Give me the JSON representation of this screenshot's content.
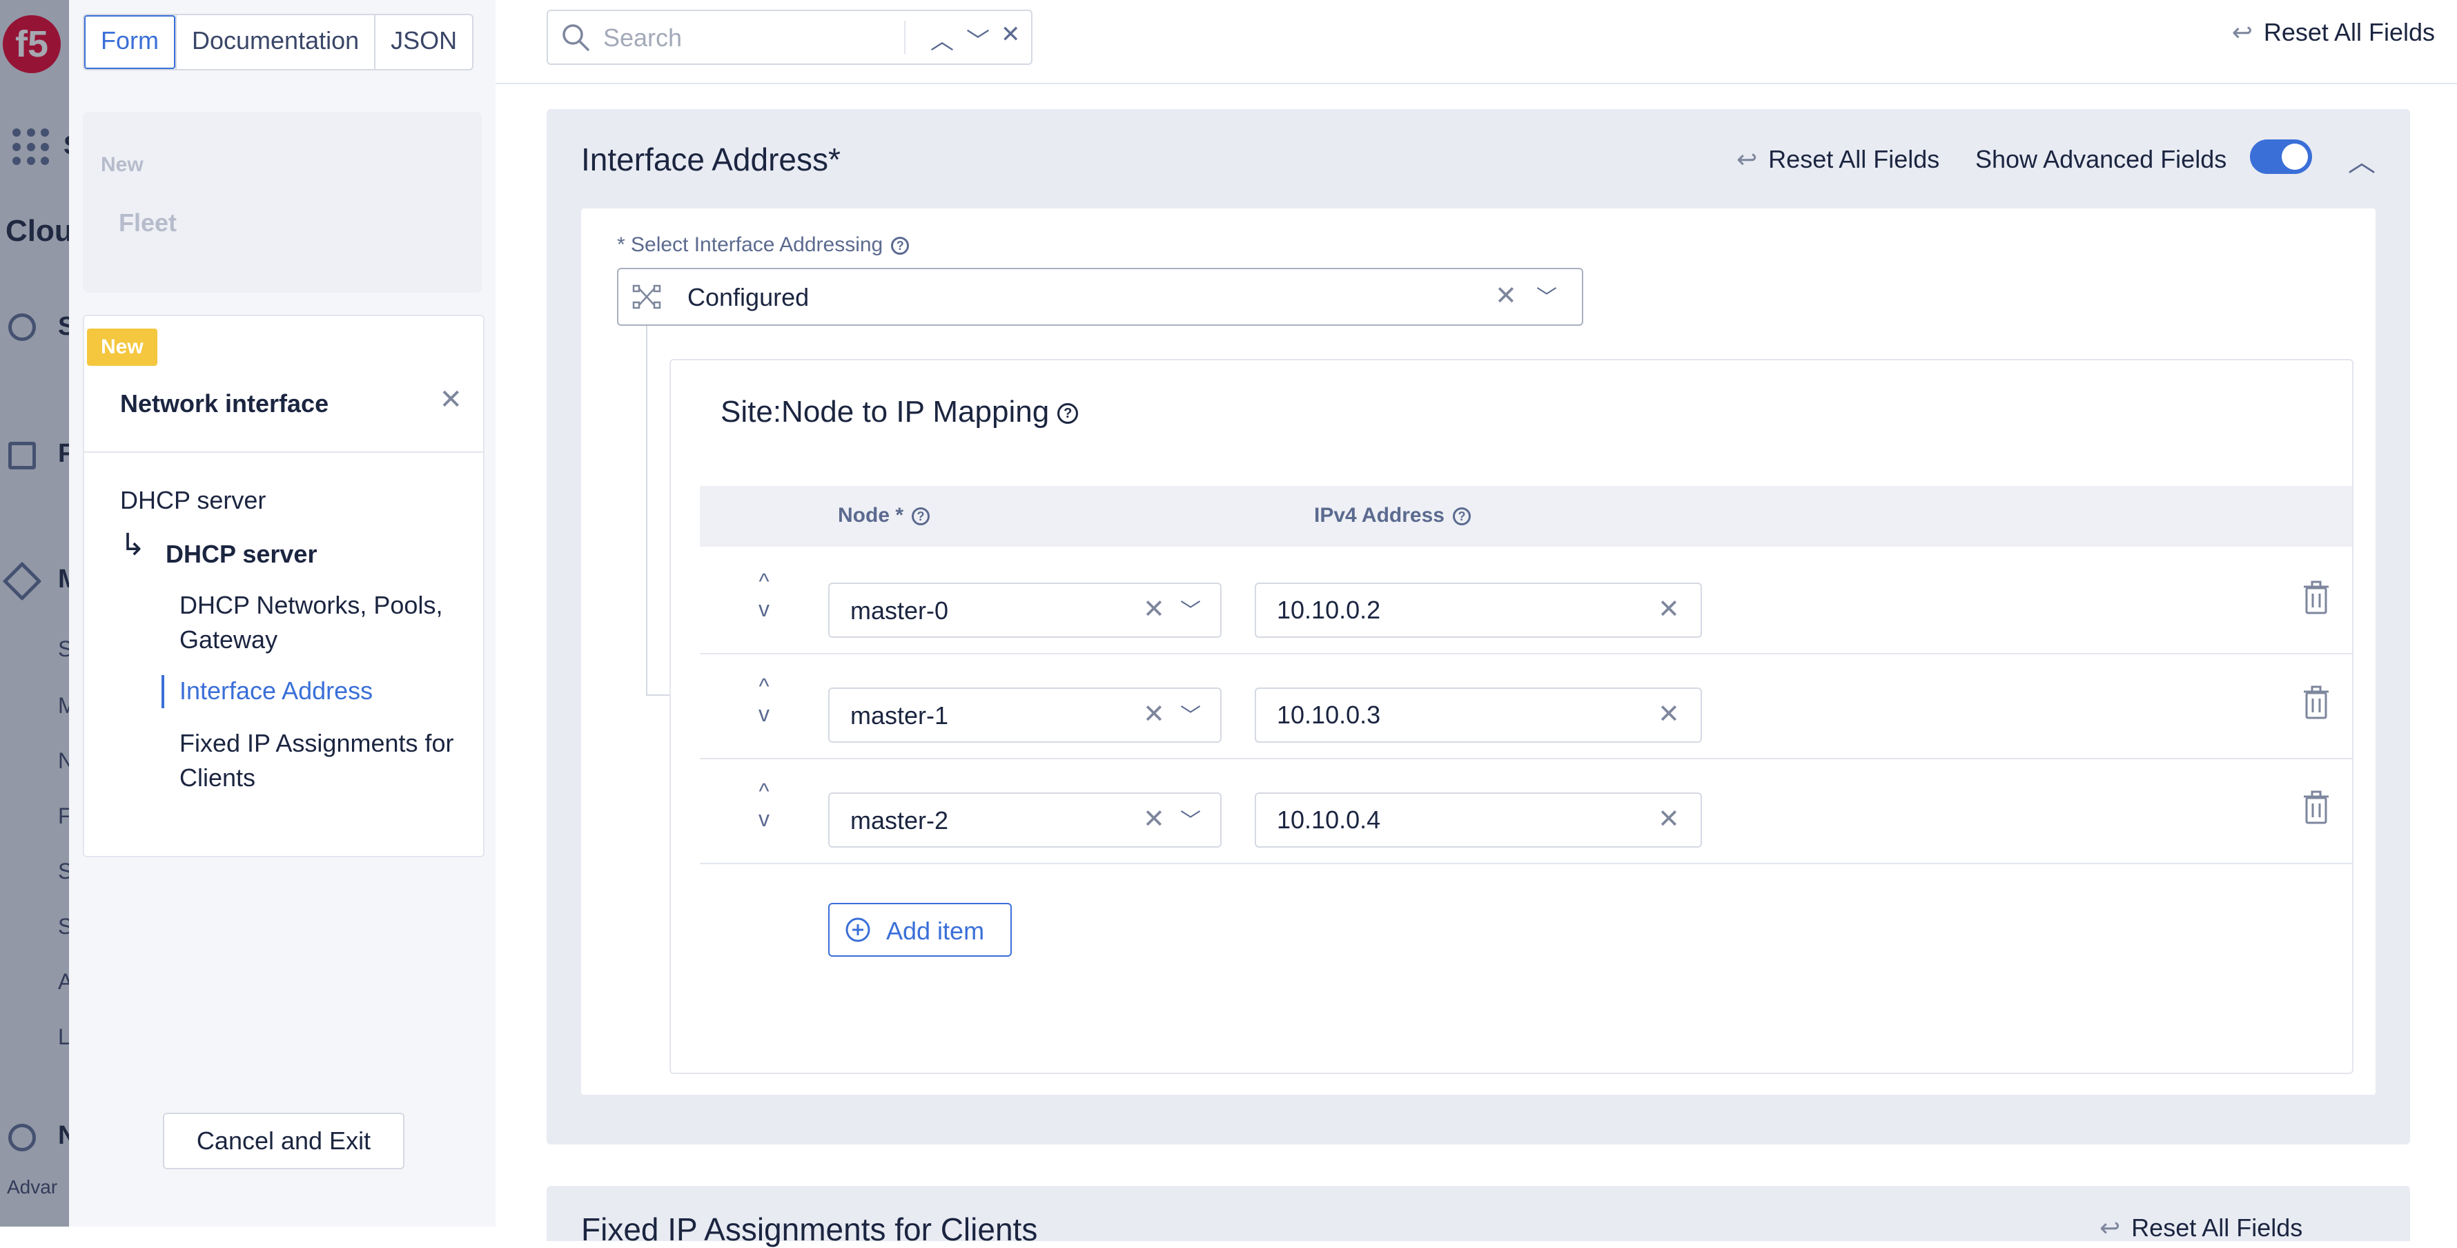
{
  "background": {
    "logo_text": "f5",
    "partial_labels": [
      "S",
      "Clou",
      "S",
      "F",
      "M",
      "S",
      "M",
      "N",
      "F",
      "S",
      "S",
      "A",
      "L",
      "N",
      "Advar"
    ]
  },
  "left_panel": {
    "tabs": [
      {
        "label": "Form",
        "active": true
      },
      {
        "label": "Documentation",
        "active": false
      },
      {
        "label": "JSON",
        "active": false
      }
    ],
    "card_new": {
      "label": "New",
      "item": "Fleet"
    },
    "card_network": {
      "badge": "New",
      "title": "Network interface",
      "close_icon": "close-icon",
      "nav": {
        "dhcp_top": "DHCP server",
        "dhcp_sub": "DHCP server",
        "networks": "DHCP Networks, Pools, Gateway",
        "interface": "Interface Address",
        "fixed_ip": "Fixed IP Assignments for Clients"
      }
    },
    "cancel_label": "Cancel and Exit"
  },
  "top_bar": {
    "search_placeholder": "Search",
    "reset_all": "Reset All Fields"
  },
  "section": {
    "title": "Interface Address",
    "required_mark": "*",
    "reset_all": "Reset All Fields",
    "advanced_label": "Show Advanced Fields",
    "advanced_enabled": true,
    "select_label": "* Select Interface Addressing",
    "select_value": "Configured",
    "mapping": {
      "title": "Site:Node to IP Mapping",
      "col_node": "Node *",
      "col_ip": "IPv4 Address",
      "rows": [
        {
          "node": "master-0",
          "ip": "10.10.0.2"
        },
        {
          "node": "master-1",
          "ip": "10.10.0.3"
        },
        {
          "node": "master-2",
          "ip": "10.10.0.4"
        }
      ],
      "add_item": "Add item"
    }
  },
  "next_section": {
    "title": "Fixed IP Assignments for Clients",
    "reset_all": "Reset All Fields"
  },
  "colors": {
    "accent": "#3a6fd8",
    "badge": "#f4c73f",
    "text": "#1b2540",
    "muted": "#5b6a8f"
  }
}
